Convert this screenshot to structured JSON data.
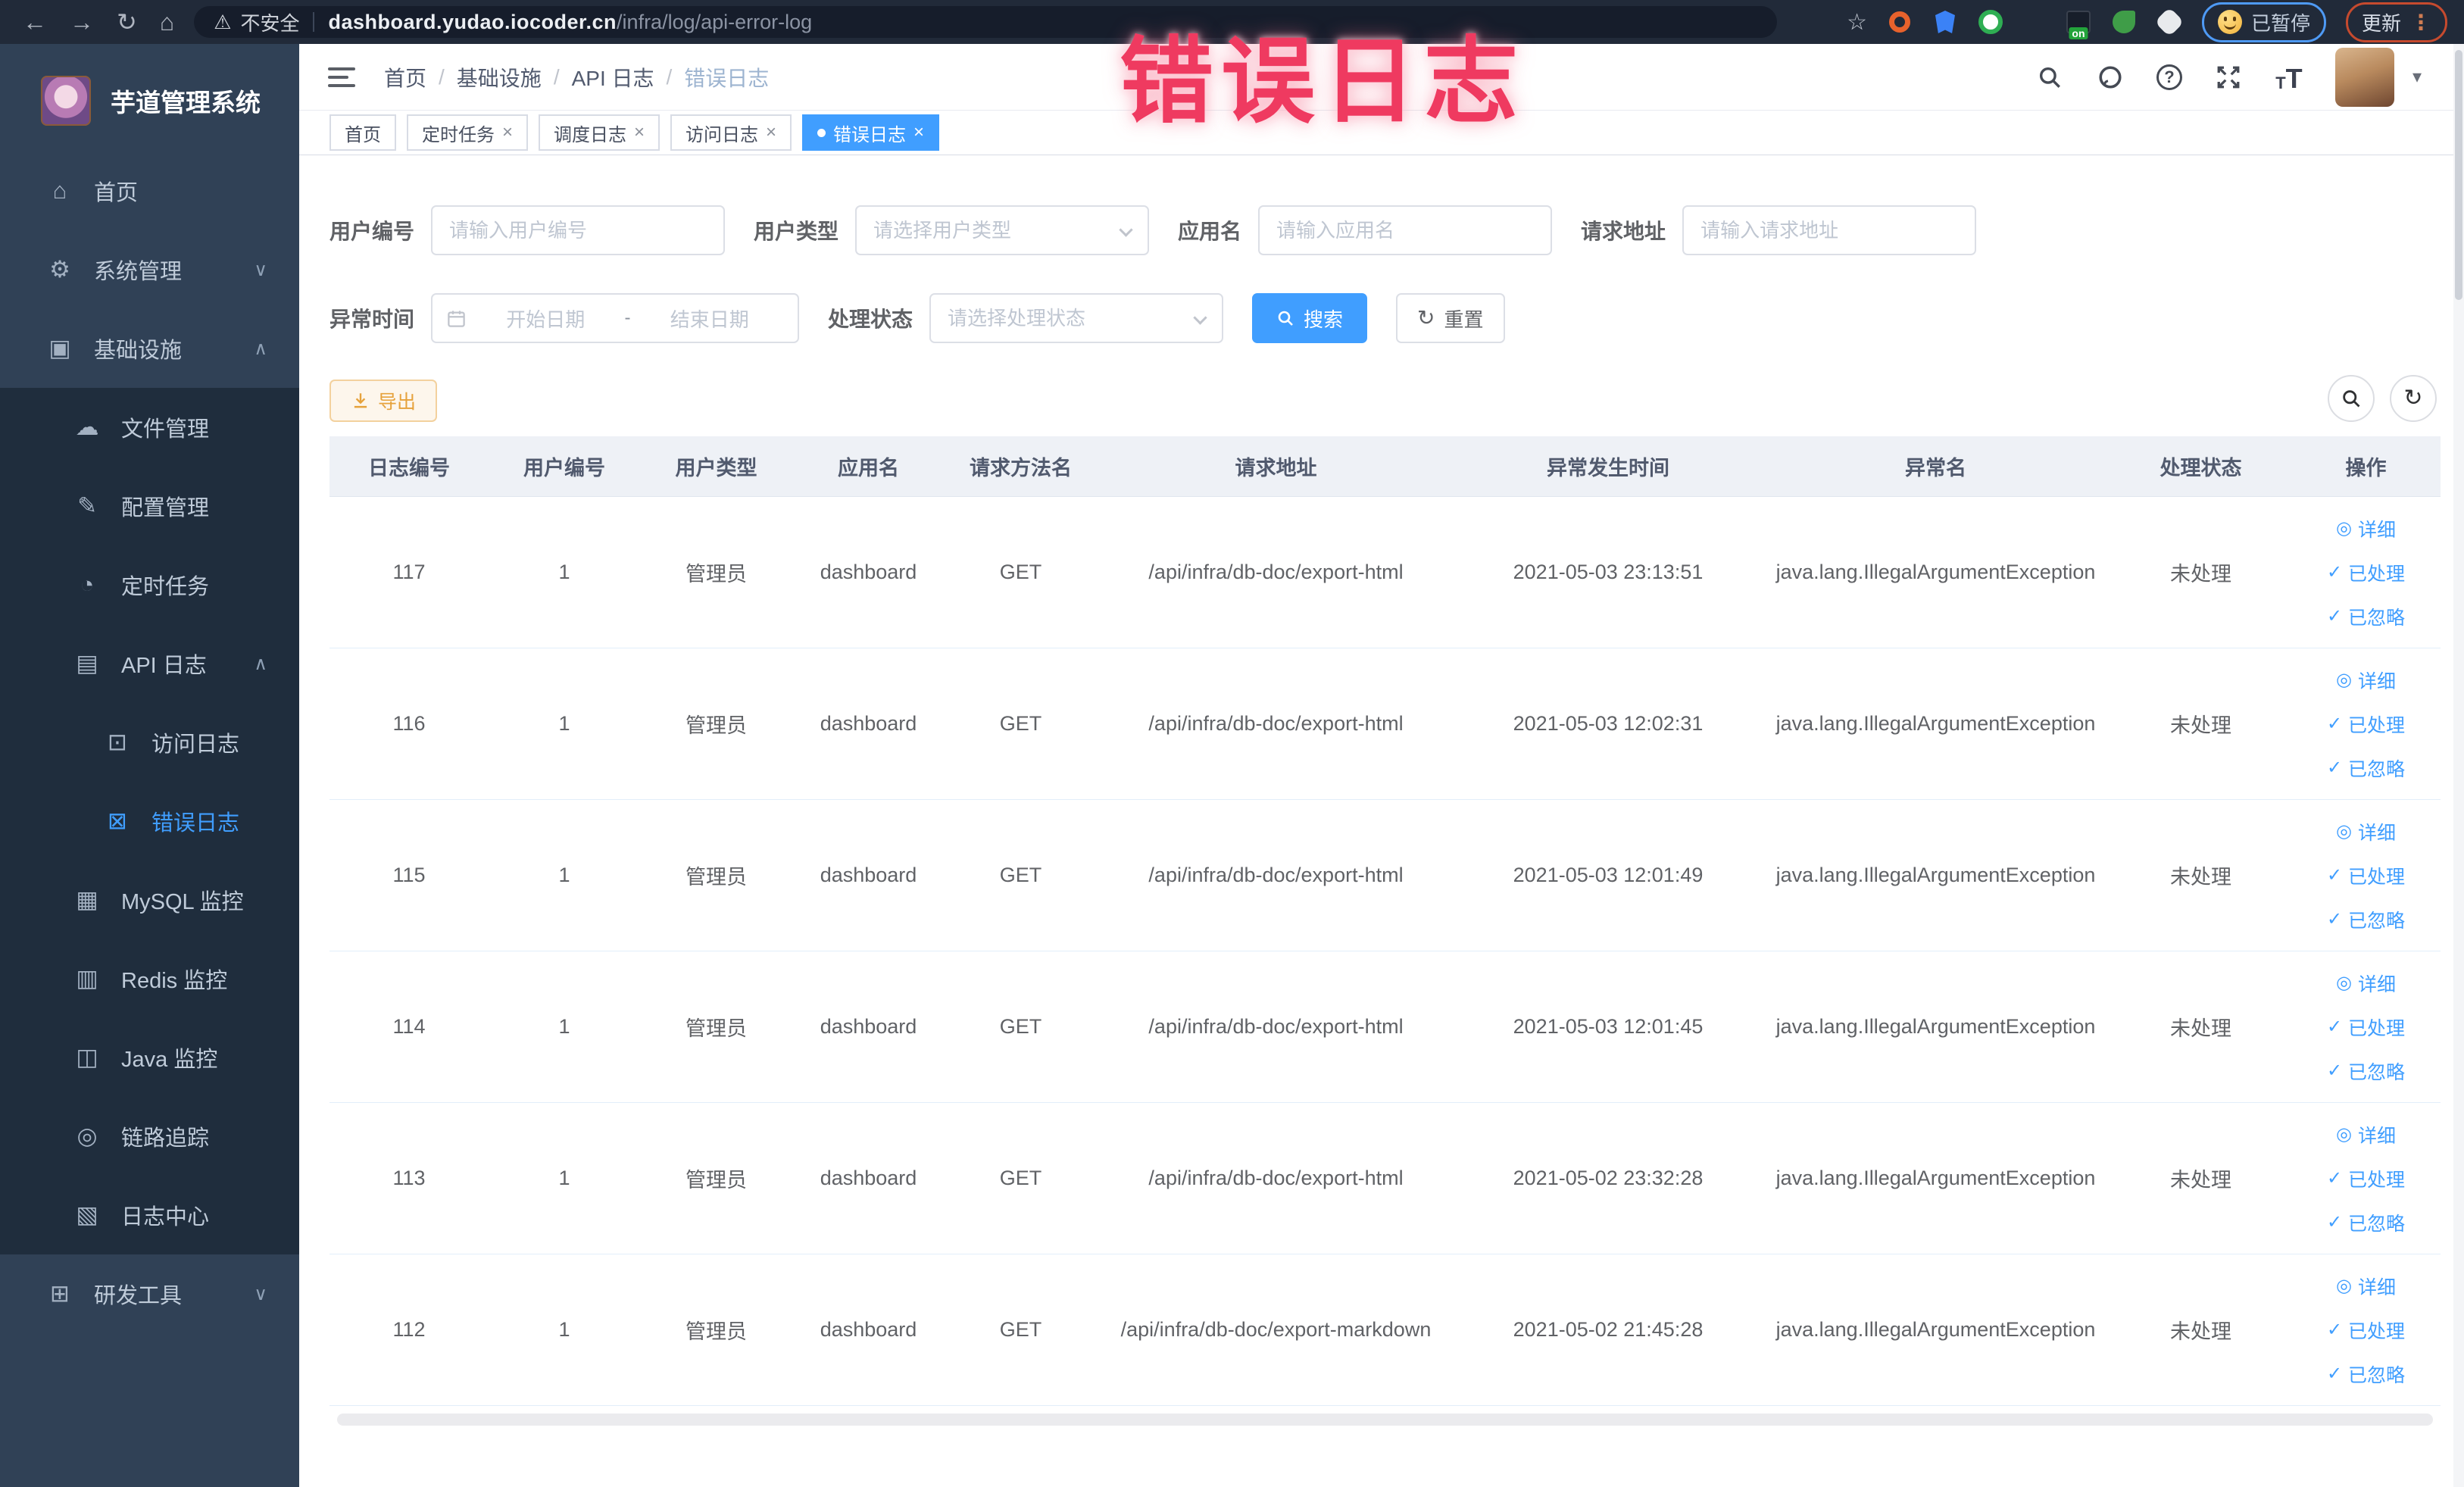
{
  "colors": {
    "accent": "#409eff",
    "warning": "#e6a23c",
    "annotation": "#ef3a60",
    "sidebar_bg": "#304156",
    "submenu_bg": "#1f2d3d"
  },
  "annotation": {
    "text": "错误日志"
  },
  "browser": {
    "back": "←",
    "forward": "→",
    "reload": "↻",
    "home": "⌂",
    "warning": "⚠",
    "security": "不安全",
    "url_domain": "dashboard.yudao.iocoder.cn",
    "url_path": "/infra/log/api-error-log",
    "star": "☆",
    "ext_on": "on",
    "paused": "已暂停",
    "update": "更新",
    "menu_dots": "⋮"
  },
  "sidebar": {
    "logo_title": "芋道管理系统",
    "home": "首页",
    "system": "系统管理",
    "infra": "基础设施",
    "devtools": "研发工具",
    "file": "文件管理",
    "config": "配置管理",
    "job": "定时任务",
    "api_log": "API 日志",
    "access_log": "访问日志",
    "error_log": "错误日志",
    "mysql": "MySQL 监控",
    "redis": "Redis 监控",
    "java": "Java 监控",
    "trace": "链路追踪",
    "log_center": "日志中心"
  },
  "icons": {
    "close": "×",
    "check": "✓",
    "eye": "◎",
    "caret_down": "▾",
    "chevron_down": "∨",
    "chevron_up": "∧",
    "home": "⌂",
    "gear": "⚙",
    "infra": "▣",
    "cloud": "☁",
    "edit": "✎",
    "clock": "◔",
    "doc": "▤",
    "access": "⊡",
    "error": "⊠",
    "mysql": "▦",
    "redis": "▥",
    "java": "◫",
    "trace_eye": "◎",
    "log_center": "▧",
    "devtools": "⊞",
    "question": "?",
    "font_t_small": "T",
    "font_t_big": "T",
    "refresh": "↻",
    "breadcrumb_sep": "/"
  },
  "header": {
    "breadcrumb": [
      "首页",
      "基础设施",
      "API 日志",
      "错误日志"
    ]
  },
  "tabs": [
    {
      "label": "首页"
    },
    {
      "label": "定时任务"
    },
    {
      "label": "调度日志"
    },
    {
      "label": "访问日志"
    },
    {
      "label": "错误日志"
    }
  ],
  "filters": {
    "user_id": {
      "label": "用户编号",
      "placeholder": "请输入用户编号"
    },
    "user_type": {
      "label": "用户类型",
      "placeholder": "请选择用户类型"
    },
    "app_name": {
      "label": "应用名",
      "placeholder": "请输入应用名"
    },
    "request_url": {
      "label": "请求地址",
      "placeholder": "请输入请求地址"
    },
    "exception_time": {
      "label": "异常时间",
      "start": "开始日期",
      "separator": "-",
      "end": "结束日期"
    },
    "process_status": {
      "label": "处理状态",
      "placeholder": "请选择处理状态"
    },
    "search": "搜索",
    "reset": "重置"
  },
  "toolbar": {
    "export": "导出"
  },
  "table": {
    "columns": [
      "日志编号",
      "用户编号",
      "用户类型",
      "应用名",
      "请求方法名",
      "请求地址",
      "异常发生时间",
      "异常名",
      "处理状态",
      "操作"
    ],
    "actions": {
      "detail": "详细",
      "processed": "已处理",
      "ignored": "已忽略"
    },
    "rows": [
      {
        "id": "117",
        "user_id": "1",
        "user_type": "管理员",
        "app": "dashboard",
        "method": "GET",
        "url": "/api/infra/db-doc/export-html",
        "time": "2021-05-03 23:13:51",
        "exception": "java.lang.IllegalArgumentException",
        "status": "未处理"
      },
      {
        "id": "116",
        "user_id": "1",
        "user_type": "管理员",
        "app": "dashboard",
        "method": "GET",
        "url": "/api/infra/db-doc/export-html",
        "time": "2021-05-03 12:02:31",
        "exception": "java.lang.IllegalArgumentException",
        "status": "未处理"
      },
      {
        "id": "115",
        "user_id": "1",
        "user_type": "管理员",
        "app": "dashboard",
        "method": "GET",
        "url": "/api/infra/db-doc/export-html",
        "time": "2021-05-03 12:01:49",
        "exception": "java.lang.IllegalArgumentException",
        "status": "未处理"
      },
      {
        "id": "114",
        "user_id": "1",
        "user_type": "管理员",
        "app": "dashboard",
        "method": "GET",
        "url": "/api/infra/db-doc/export-html",
        "time": "2021-05-03 12:01:45",
        "exception": "java.lang.IllegalArgumentException",
        "status": "未处理"
      },
      {
        "id": "113",
        "user_id": "1",
        "user_type": "管理员",
        "app": "dashboard",
        "method": "GET",
        "url": "/api/infra/db-doc/export-html",
        "time": "2021-05-02 23:32:28",
        "exception": "java.lang.IllegalArgumentException",
        "status": "未处理"
      },
      {
        "id": "112",
        "user_id": "1",
        "user_type": "管理员",
        "app": "dashboard",
        "method": "GET",
        "url": "/api/infra/db-doc/export-markdown",
        "time": "2021-05-02 21:45:28",
        "exception": "java.lang.IllegalArgumentException",
        "status": "未处理"
      }
    ]
  }
}
